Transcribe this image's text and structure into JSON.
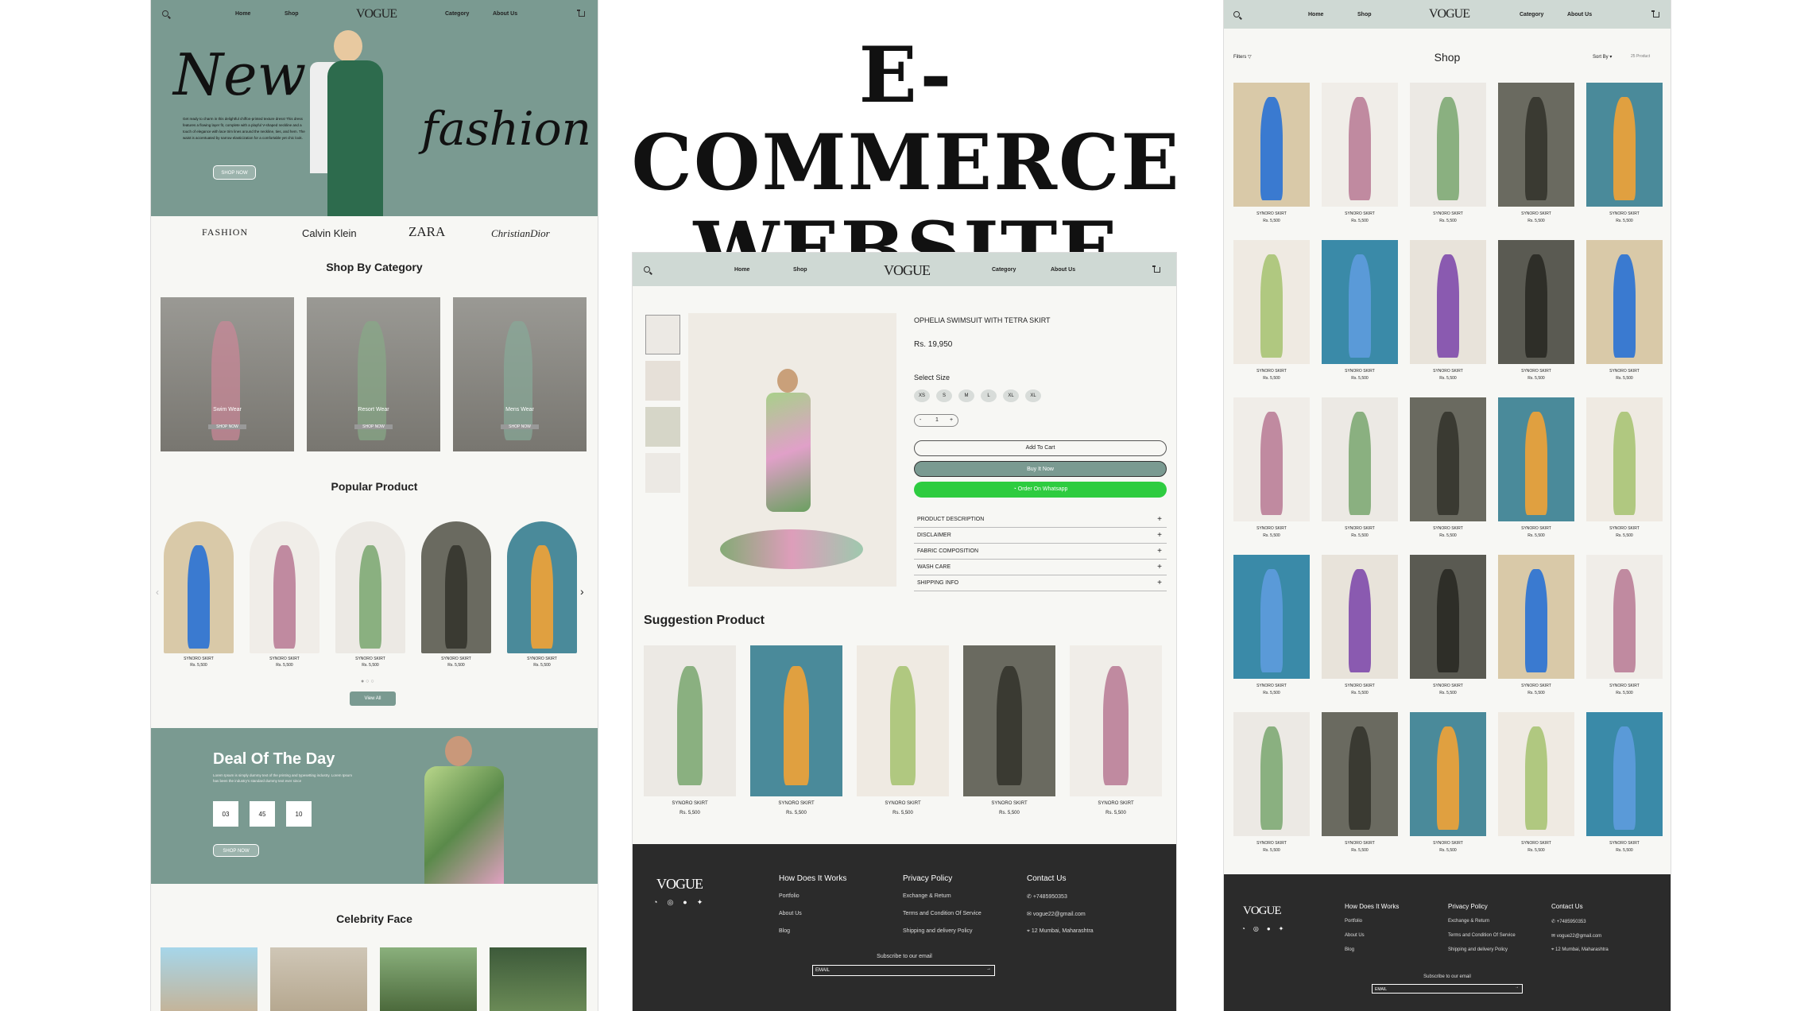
{
  "headline": {
    "line1": "E-COMMERCE",
    "line2": "WEBSITE"
  },
  "brand": "VOGUE",
  "nav": {
    "home": "Home",
    "shop": "Shop",
    "category": "Category",
    "about": "About Us"
  },
  "hero": {
    "title1": "New",
    "title2": "fashion",
    "body": "Get ready to charm in this delightful chiffon-printed texture dress! This dress features a flowing layer fit, complete with a playful V-shaped neckline and a touch of elegance with lace trim lines around the neckline, ties, and hem. The waist is accentuated by narrow elasticization for a comfortable yet chic look.",
    "cta": "SHOP NOW"
  },
  "brands": [
    "FASHION",
    "Calvin Klein",
    "ZARA",
    "ChristianDior"
  ],
  "shop_by_category": {
    "title": "Shop By Category",
    "items": [
      {
        "label": "Swim Wear",
        "cta": "SHOP NOW"
      },
      {
        "label": "Resort Wear",
        "cta": "SHOP NOW"
      },
      {
        "label": "Mens Wear",
        "cta": "SHOP NOW"
      }
    ]
  },
  "popular": {
    "title": "Popular Product",
    "name": "SYNORO SKIRT",
    "price": "Rs. 5,500",
    "view_all": "View All"
  },
  "deal": {
    "title": "Deal Of The Day",
    "body": "Lorem Ipsum is simply dummy text of the printing and typesetting industry. Lorem Ipsum has been the industry's standard dummy text ever since",
    "timer": [
      "03",
      "45",
      "10"
    ],
    "cta": "SHOP NOW"
  },
  "celebrity": {
    "title": "Celebrity Face"
  },
  "product": {
    "name": "OPHELIA SWIMSUIT WITH TETRA SKIRT",
    "price": "Rs. 19,950",
    "select_size": "Select Size",
    "sizes": [
      "XS",
      "S",
      "M",
      "L",
      "XL",
      "XL"
    ],
    "qty": "1",
    "minus": "-",
    "plus": "+",
    "add_to_cart": "Add To Cart",
    "buy_now": "Buy It Now",
    "whatsapp": "Order On Whatsapp",
    "accordion": [
      "PRODUCT DESCRIPTION",
      "DISCLAIMER",
      "FABRIC COMPOSITION",
      "WASH CARE",
      "SHIPPING INFO"
    ]
  },
  "suggestion": {
    "title": "Suggestion Product",
    "name": "SYNORO SKIRT",
    "price": "Rs. 5,500"
  },
  "shop_page": {
    "title": "Shop",
    "filters": "Filters",
    "sort": "Sort By",
    "count": "25 Product",
    "name": "SYNORO SKIRT",
    "price": "Rs. 5,500"
  },
  "footer": {
    "how": "How Does It Works",
    "privacy": "Privacy Policy",
    "contact": "Contact Us",
    "how_links": [
      "Portfolio",
      "About Us",
      "Blog"
    ],
    "privacy_links": [
      "Exchange & Return",
      "Terms and Condition Of Service",
      "Shipping and delivery Policy"
    ],
    "contact_links": [
      "+7485950353",
      "vogue22@gmail.com",
      "12 Mumbai, Maharashtra"
    ],
    "subscribe": "Subscribe to our email",
    "email_placeholder": "EMAIL"
  },
  "colors": {
    "sage": "#7a9a91",
    "nav": "#cfd9d4",
    "footer": "#2b2b2b",
    "whatsapp": "#2ecc40"
  }
}
